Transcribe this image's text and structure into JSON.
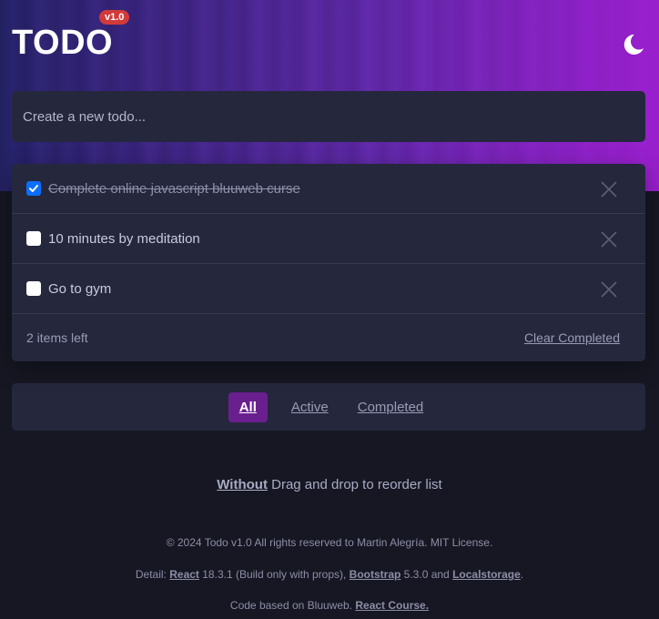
{
  "header": {
    "title": "TODO",
    "version_badge": "v1.0",
    "theme_icon": "moon-icon"
  },
  "new_todo": {
    "placeholder": "Create a new todo..."
  },
  "todos": [
    {
      "text": "Complete online javascript bluuweb curse",
      "completed": true
    },
    {
      "text": "10 minutes by meditation",
      "completed": false
    },
    {
      "text": "Go to gym",
      "completed": false
    }
  ],
  "list_footer": {
    "items_left": "2 items left",
    "clear_label": "Clear Completed"
  },
  "filters": [
    {
      "label": "All",
      "active": true
    },
    {
      "label": "Active",
      "active": false
    },
    {
      "label": "Completed",
      "active": false
    }
  ],
  "dnd_note": {
    "emphasis": "Without",
    "rest": " Drag and drop to reorder list"
  },
  "footer": {
    "copyright": "© 2024 Todo v1.0 All rights reserved to Martin Alegría. MIT License.",
    "detail_prefix": "Detail: ",
    "react_link": "React",
    "react_version": " 18.3.1 (Build only with props), ",
    "bootstrap_link": "Bootstrap",
    "bootstrap_version": " 5.3.0 and ",
    "localstorage_link": " Localstorage",
    "detail_suffix": ".",
    "credit_prefix": "Code based on Bluuweb. ",
    "course_link": "React Course."
  },
  "colors": {
    "accent": "#6a1f8e",
    "checked": "#0d6efd",
    "badge": "#d23a3a",
    "card": "#25273d",
    "background": "#171723"
  }
}
